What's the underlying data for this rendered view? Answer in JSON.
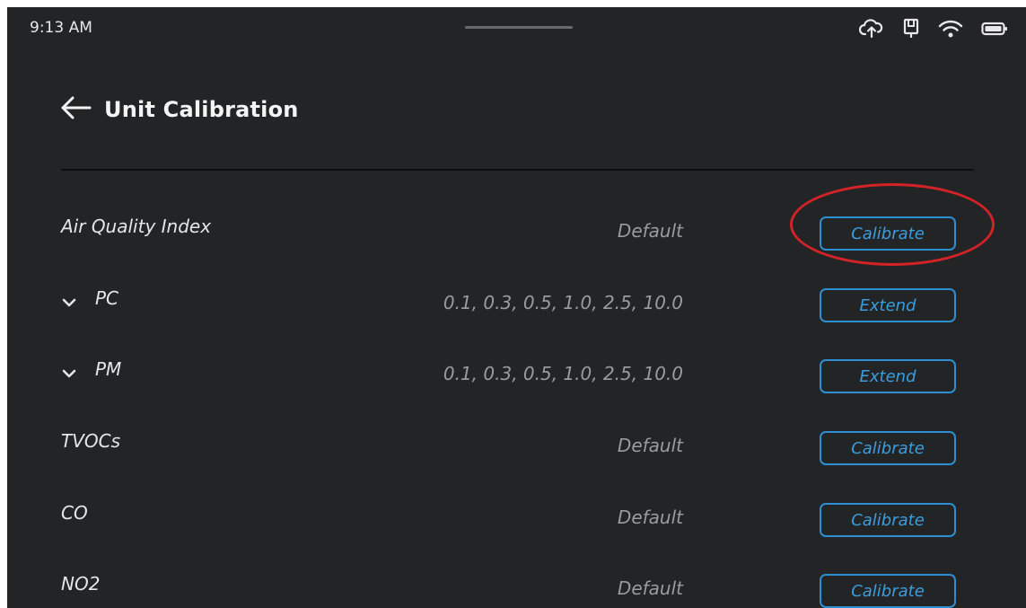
{
  "status_bar": {
    "time": "9:13 AM",
    "icons": [
      "cloud-upload-icon",
      "device-icon",
      "wifi-icon",
      "battery-icon"
    ]
  },
  "header": {
    "title": "Unit Calibration"
  },
  "rows": [
    {
      "label": "Air Quality Index",
      "value": "Default",
      "button": "Calibrate",
      "expandable": false
    },
    {
      "label": "PC",
      "value": "0.1, 0.3, 0.5, 1.0, 2.5, 10.0",
      "button": "Extend",
      "expandable": true
    },
    {
      "label": "PM",
      "value": "0.1, 0.3, 0.5, 1.0, 2.5, 10.0",
      "button": "Extend",
      "expandable": true
    },
    {
      "label": "TVOCs",
      "value": "Default",
      "button": "Calibrate",
      "expandable": false
    },
    {
      "label": "CO",
      "value": "Default",
      "button": "Calibrate",
      "expandable": false
    },
    {
      "label": "NO2",
      "value": "Default",
      "button": "Calibrate",
      "expandable": false
    }
  ],
  "colors": {
    "background": "#232426",
    "accent": "#2d8ed0",
    "highlight": "#d42326"
  }
}
